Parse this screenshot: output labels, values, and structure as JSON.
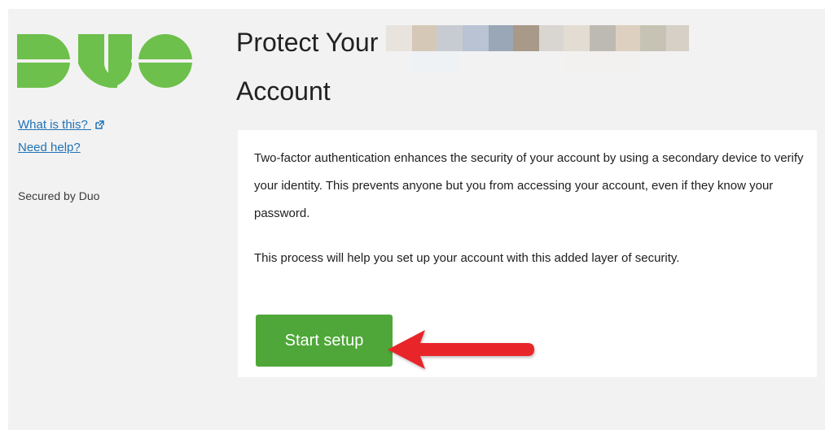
{
  "sidebar": {
    "logo_alt": "Duo",
    "links": {
      "what_is_this": "What is this?",
      "need_help": "Need help?"
    },
    "secured_by": "Secured by Duo"
  },
  "header": {
    "title_line1": "Protect Your",
    "title_line2": "Account"
  },
  "card": {
    "paragraph1": "Two-factor authentication enhances the security of your account by using a secondary device to verify your identity. This prevents anyone but you from accessing your account, even if they know your password.",
    "paragraph2": "This process will help you set up your account with this added layer of security.",
    "start_button": "Start setup"
  },
  "colors": {
    "brand_green": "#6dc04b",
    "button_green": "#4ea738",
    "link_blue": "#1f73b7",
    "arrow_red": "#e8262a"
  },
  "icons": {
    "external_link": "external-link-icon",
    "annotation_arrow": "arrow-left-icon"
  }
}
